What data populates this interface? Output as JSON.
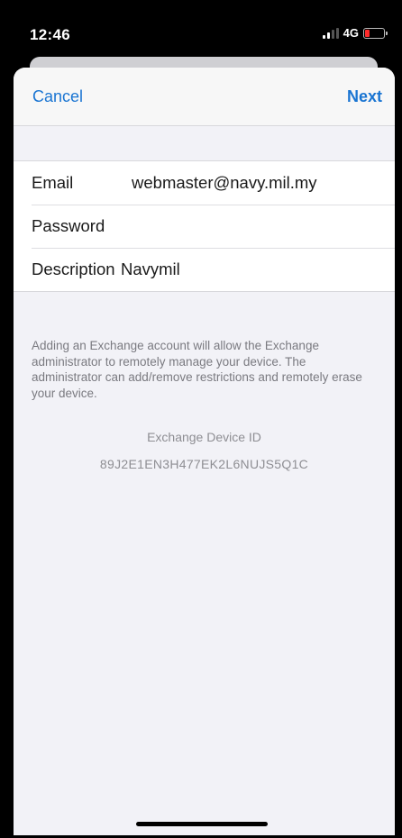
{
  "status_bar": {
    "time": "12:46",
    "network": "4G",
    "icons": [
      "signal-icon",
      "battery-low-icon"
    ],
    "battery_color": "#ff2b2b"
  },
  "nav": {
    "cancel_label": "Cancel",
    "next_label": "Next",
    "accent_color": "#1a75d2"
  },
  "form": {
    "email_label": "Email",
    "email_value": "webmaster@navy.mil.my",
    "password_label": "Password",
    "password_value": "",
    "description_label": "Description",
    "description_value": "Navymil"
  },
  "info": {
    "text": "Adding an Exchange account will allow the Exchange administrator to remotely manage your device. The administrator can add/remove restrictions and remotely erase your device.",
    "device_id_label": "Exchange Device ID",
    "device_id_value": "89J2E1EN3H477EK2L6NUJS5Q1C"
  }
}
